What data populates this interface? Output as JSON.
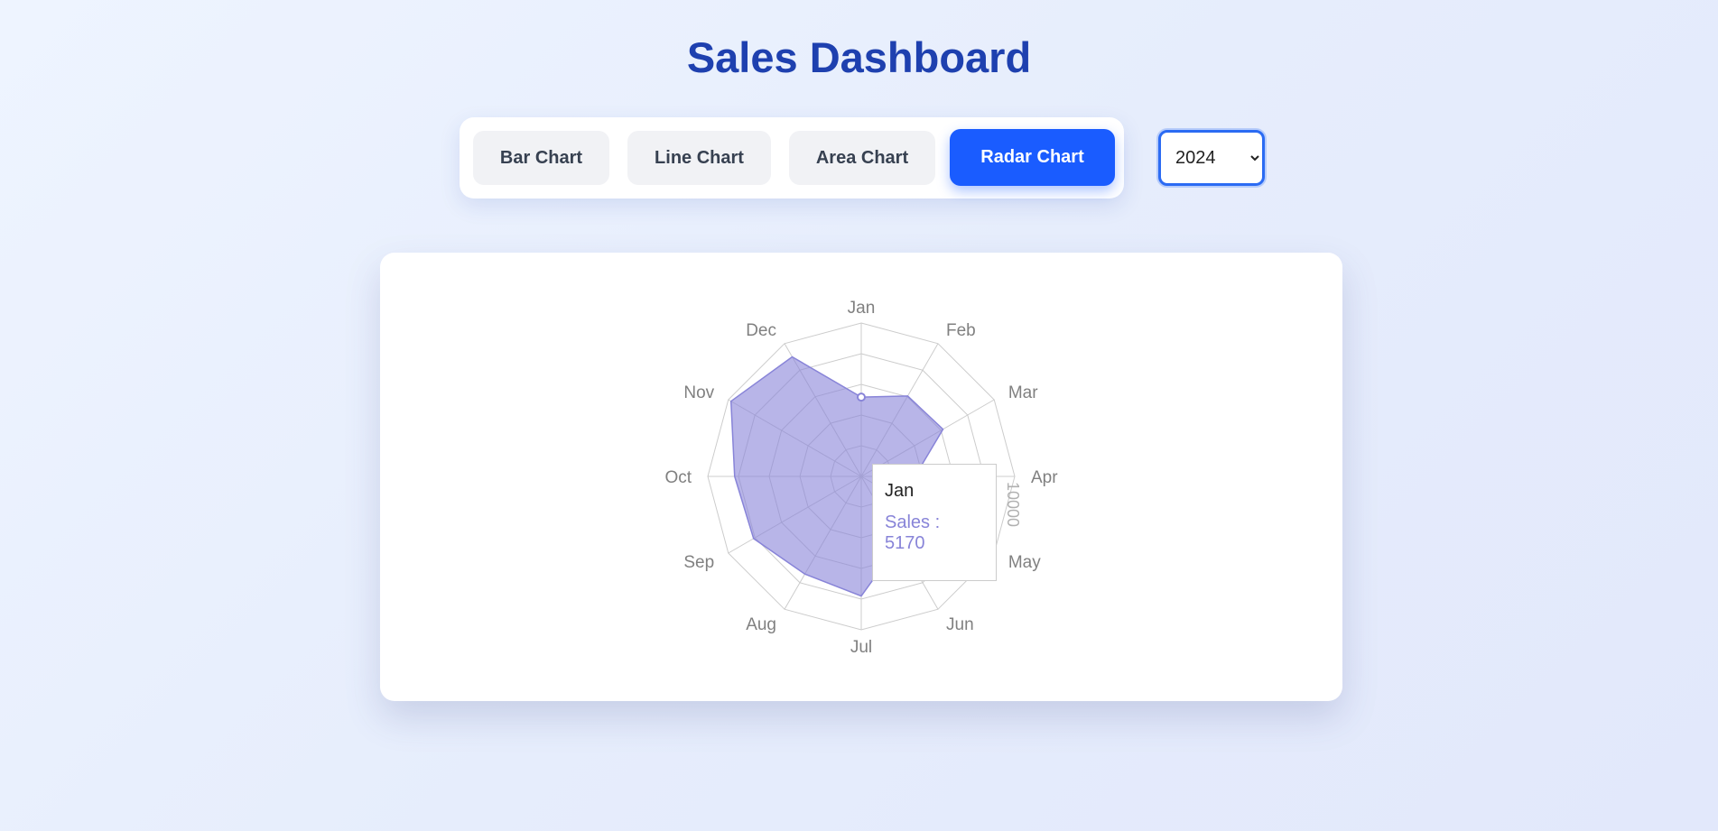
{
  "header": {
    "title": "Sales Dashboard"
  },
  "tabs": [
    {
      "label": "Bar Chart",
      "active": false
    },
    {
      "label": "Line Chart",
      "active": false
    },
    {
      "label": "Area Chart",
      "active": false
    },
    {
      "label": "Radar Chart",
      "active": true
    }
  ],
  "year_select": {
    "value": "2024",
    "options": [
      "2024"
    ]
  },
  "colors": {
    "accent": "#1a5cff",
    "title": "#1e40af",
    "series_fill": "#8884d8"
  },
  "tooltip": {
    "label": "Jan",
    "series": "Sales",
    "value": "5170"
  },
  "chart_data": {
    "type": "radar",
    "categories": [
      "Jan",
      "Feb",
      "Mar",
      "Apr",
      "May",
      "Jun",
      "Jul",
      "Aug",
      "Sep",
      "Oct",
      "Nov",
      "Dec"
    ],
    "series": [
      {
        "name": "Sales",
        "values": [
          5170,
          6050,
          6150,
          3500,
          3300,
          5000,
          7800,
          7350,
          8100,
          8250,
          9800,
          9000
        ]
      }
    ],
    "radius_axis": {
      "max": 10000,
      "tick_label": "10000"
    },
    "highlighted_category": "Jan"
  }
}
